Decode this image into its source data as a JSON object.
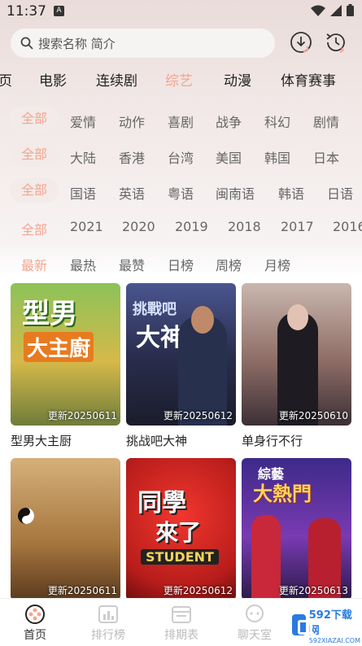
{
  "status": {
    "time": "11:37",
    "notif_letter": "A"
  },
  "search": {
    "placeholder": "搜索名称 简介"
  },
  "tabs": [
    {
      "label": "页"
    },
    {
      "label": "电影"
    },
    {
      "label": "连续剧"
    },
    {
      "label": "综艺"
    },
    {
      "label": "动漫"
    },
    {
      "label": "体育赛事"
    }
  ],
  "active_tab": "综艺",
  "filters": {
    "genre": [
      "全部",
      "爱情",
      "动作",
      "喜剧",
      "战争",
      "科幻",
      "剧情"
    ],
    "region": [
      "全部",
      "大陆",
      "香港",
      "台湾",
      "美国",
      "韩国",
      "日本"
    ],
    "language": [
      "全部",
      "国语",
      "英语",
      "粤语",
      "闽南语",
      "韩语",
      "日语"
    ],
    "year": [
      "全部",
      "2021",
      "2020",
      "2019",
      "2018",
      "2017",
      "2016"
    ],
    "sort": [
      "最新",
      "最热",
      "最赞",
      "日榜",
      "周榜",
      "月榜"
    ]
  },
  "cards": [
    {
      "title": "型男大主厨",
      "update": "更新20250611",
      "poster_text": "型男 大主廚",
      "bg": "#7bb04a"
    },
    {
      "title": "挑战吧大神",
      "update": "更新20250612",
      "poster_text": "挑戰吧 大神",
      "bg": "#3a3f6a"
    },
    {
      "title": "单身行不行",
      "update": "更新20250610",
      "poster_text": "",
      "bg": "#8c6f6a"
    },
    {
      "title": "",
      "update": "更新20250611",
      "poster_text": "",
      "bg": "#b08850"
    },
    {
      "title": "",
      "update": "更新20250612",
      "poster_text": "同學 來了 STUDENT",
      "bg": "#d8302a"
    },
    {
      "title": "",
      "update": "更新20250613",
      "poster_text": "綜藝 大熱門",
      "bg": "#6a3aa0"
    }
  ],
  "bottom_nav": [
    {
      "label": "首页",
      "icon": "home-film-icon"
    },
    {
      "label": "排行榜",
      "icon": "chart-icon"
    },
    {
      "label": "排期表",
      "icon": "calendar-icon"
    },
    {
      "label": "聊天室",
      "icon": "chat-icon"
    }
  ],
  "watermark": {
    "name": "592下载网",
    "url": "592XIAZAI.COM"
  },
  "colors": {
    "accent": "#f4a58e",
    "text": "#222222",
    "muted": "#666666"
  }
}
